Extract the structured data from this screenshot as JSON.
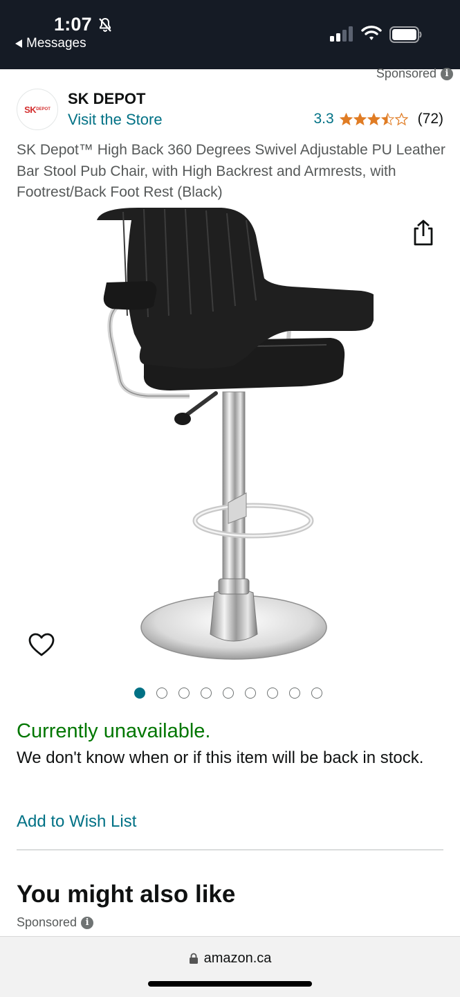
{
  "status_bar": {
    "time": "1:07",
    "back_label": "Messages",
    "icons": [
      "bell-slash-icon",
      "cellular-signal-icon",
      "wifi-icon",
      "battery-icon"
    ]
  },
  "sponsored_top": "Sponsored",
  "brand": {
    "logo_text": "SK",
    "logo_subtext": "DEPOT",
    "name": "SK DEPOT",
    "store_link": "Visit the Store"
  },
  "rating": {
    "value": "3.3",
    "stars": 3.5,
    "count": "(72)"
  },
  "product": {
    "title": "SK Depot™ High Back 360 Degrees Swivel Adjustable PU Leather Bar Stool Pub Chair, with High Backrest and Armrests, with Footrest/Back Foot Rest (Black)",
    "image_count": 9,
    "active_image_index": 0
  },
  "availability": {
    "status": "Currently unavailable.",
    "note": "We don't know when or if this item will be back in stock."
  },
  "actions": {
    "wish_list": "Add to Wish List"
  },
  "recommendations": {
    "title": "You might also like",
    "sponsored": "Sponsored"
  },
  "browser": {
    "url": "amazon.ca"
  },
  "colors": {
    "link": "#007185",
    "available_green": "#007600",
    "star": "#e07c24",
    "status_bar_bg": "#151b25"
  }
}
